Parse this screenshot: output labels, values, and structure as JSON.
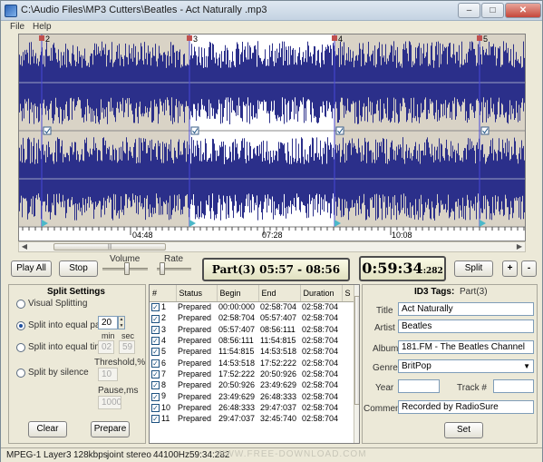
{
  "window": {
    "title": "C:\\Audio Files\\MP3 Cutters\\Beatles - Act Naturally .mp3",
    "minimize_glyph": "–",
    "maximize_glyph": "□",
    "close_glyph": "✕"
  },
  "menu": [
    "File",
    "Help"
  ],
  "waveform": {
    "markers": [
      "2",
      "3",
      "4",
      "5"
    ],
    "timeline_labels": [
      "04:48",
      "07:28",
      "10:08"
    ],
    "selected_part": "3"
  },
  "controls": {
    "play_all": "Play All",
    "stop": "Stop",
    "volume_label": "Volume",
    "rate_label": "Rate",
    "part_display": "Part(3)  05:57 - 08:56",
    "time_main": "0:59:34",
    "time_ms": ":282",
    "split": "Split",
    "plus": "+",
    "minus": "-",
    "volume_level": 0.55,
    "rate_level": 0.1
  },
  "split_settings": {
    "title": "Split Settings",
    "options": [
      {
        "label": "Visual Splitting",
        "selected": false
      },
      {
        "label": "Split into equal parts",
        "selected": true
      },
      {
        "label": "Split into equal time",
        "selected": false
      },
      {
        "label": "Split by silence",
        "selected": false
      }
    ],
    "parts_value": "20",
    "min_label": "min",
    "sec_label": "sec",
    "min_value": "02",
    "sec_value": "59",
    "threshold_label": "Threshold,%",
    "threshold_value": "10",
    "pause_label": "Pause,ms",
    "pause_value": "1000",
    "clear": "Clear",
    "prepare": "Prepare"
  },
  "table": {
    "columns": [
      "#",
      "Status",
      "Begin",
      "End",
      "Duration",
      "S"
    ],
    "rows": [
      {
        "n": "1",
        "status": "Prepared",
        "begin": "00:00:000",
        "end": "02:58:704",
        "duration": "02:58:704"
      },
      {
        "n": "2",
        "status": "Prepared",
        "begin": "02:58:704",
        "end": "05:57:407",
        "duration": "02:58:704"
      },
      {
        "n": "3",
        "status": "Prepared",
        "begin": "05:57:407",
        "end": "08:56:111",
        "duration": "02:58:704"
      },
      {
        "n": "4",
        "status": "Prepared",
        "begin": "08:56:111",
        "end": "11:54:815",
        "duration": "02:58:704"
      },
      {
        "n": "5",
        "status": "Prepared",
        "begin": "11:54:815",
        "end": "14:53:518",
        "duration": "02:58:704"
      },
      {
        "n": "6",
        "status": "Prepared",
        "begin": "14:53:518",
        "end": "17:52:222",
        "duration": "02:58:704"
      },
      {
        "n": "7",
        "status": "Prepared",
        "begin": "17:52:222",
        "end": "20:50:926",
        "duration": "02:58:704"
      },
      {
        "n": "8",
        "status": "Prepared",
        "begin": "20:50:926",
        "end": "23:49:629",
        "duration": "02:58:704"
      },
      {
        "n": "9",
        "status": "Prepared",
        "begin": "23:49:629",
        "end": "26:48:333",
        "duration": "02:58:704"
      },
      {
        "n": "10",
        "status": "Prepared",
        "begin": "26:48:333",
        "end": "29:47:037",
        "duration": "02:58:704"
      },
      {
        "n": "11",
        "status": "Prepared",
        "begin": "29:47:037",
        "end": "32:45:740",
        "duration": "02:58:704"
      }
    ]
  },
  "id3": {
    "title": "ID3 Tags:",
    "part": "Part(3)",
    "title_label": "Title",
    "title_value": "Act Naturally",
    "artist_label": "Artist",
    "artist_value": "Beatles",
    "album_label": "Album",
    "album_value": "181.FM - The Beatles Channel",
    "genre_label": "Genre",
    "genre_value": "BritPop",
    "year_label": "Year",
    "year_value": "",
    "track_label": "Track #",
    "track_value": "",
    "comment_label": "Comment",
    "comment_value": "Recorded by RadioSure",
    "set": "Set"
  },
  "status": {
    "format": "MPEG-1",
    "layer": "Layer3",
    "bitrate": "128kbps",
    "mode": "joint stereo",
    "rate": "44100Hz",
    "length": "59:34:282",
    "watermark": "WWW.FREE-DOWNLOAD.COM"
  },
  "colors": {
    "wave_fill": "#2b2f8a",
    "wave_bg_unselected": "#d9d3c6",
    "wave_bg_selected": "#ffffff",
    "marker_line": "#4747d8",
    "marker_x": "#c0504d",
    "cursor_triangle": "#4bb8c9"
  }
}
